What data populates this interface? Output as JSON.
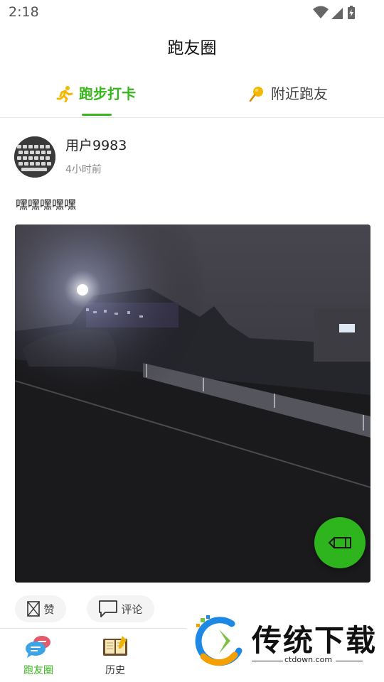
{
  "status_bar": {
    "time": "2:18",
    "icons": [
      "wifi-icon",
      "signal-icon",
      "battery-charging-icon"
    ]
  },
  "header": {
    "title": "跑友圈"
  },
  "tabs": [
    {
      "label": "跑步打卡",
      "icon": "runner-icon",
      "active": true
    },
    {
      "label": "附近跑友",
      "icon": "location-pin-icon",
      "active": false
    }
  ],
  "post": {
    "username": "用户9983",
    "time": "4小时前",
    "text": "嘿嘿嘿嘿嘿",
    "like_label": "赞",
    "comment_label": "评论"
  },
  "fab": {
    "icon": "pencil-icon"
  },
  "bottom_nav": [
    {
      "label": "跑友圈",
      "icon": "chat-bubbles-icon",
      "active": true
    },
    {
      "label": "历史",
      "icon": "book-icon",
      "active": false
    }
  ],
  "watermark": {
    "text": "传统下载",
    "url": "ctdown.com"
  },
  "colors": {
    "accent": "#38b61c",
    "fab": "#2eb51e"
  }
}
